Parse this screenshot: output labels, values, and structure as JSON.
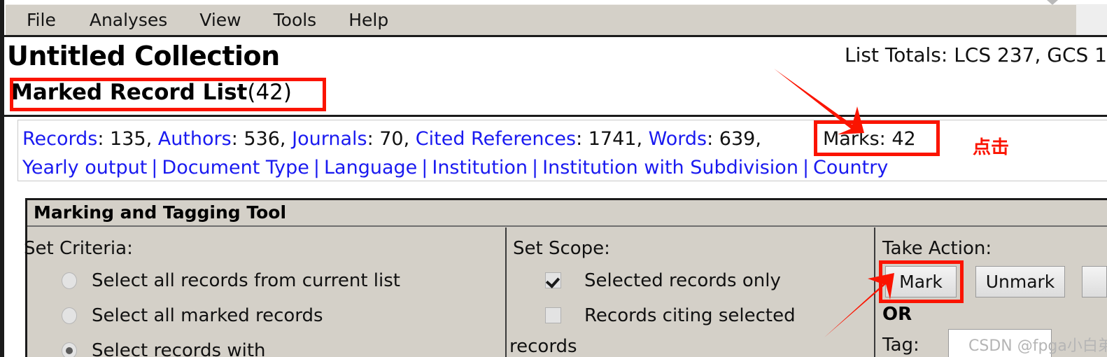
{
  "menubar": {
    "items": [
      {
        "label": "File"
      },
      {
        "label": "Analyses"
      },
      {
        "label": "View"
      },
      {
        "label": "Tools"
      },
      {
        "label": "Help"
      }
    ]
  },
  "header": {
    "collection_title": "Untitled Collection",
    "list_totals": "List Totals: LCS 237, GCS 1",
    "subtitle_label": "Marked Record List",
    "subtitle_count": "(42)"
  },
  "stats": {
    "line1": [
      {
        "text": "Records",
        "type": "link"
      },
      {
        "text": ": 135, ",
        "type": "plain"
      },
      {
        "text": "Authors",
        "type": "link"
      },
      {
        "text": ": 536, ",
        "type": "plain"
      },
      {
        "text": "Journals",
        "type": "link"
      },
      {
        "text": ": 70, ",
        "type": "plain"
      },
      {
        "text": "Cited References",
        "type": "link"
      },
      {
        "text": ": 1741, ",
        "type": "plain"
      },
      {
        "text": "Words",
        "type": "link"
      },
      {
        "text": ": 639,",
        "type": "plain"
      }
    ],
    "line1_flat": "Records: 135, Authors: 536, Journals: 70, Cited References: 1741, Words: 639,",
    "records_label": "Records",
    "records_value": ": 135, ",
    "authors_label": "Authors",
    "authors_value": ": 536, ",
    "journals_label": "Journals",
    "journals_value": ": 70, ",
    "cited_refs_label": "Cited References",
    "cited_refs_value": ": 1741, ",
    "words_label": "Words",
    "words_value": ": 639,",
    "marks_text": "Marks: 42",
    "links_row": [
      {
        "label": "Yearly output"
      },
      {
        "label": "Document Type"
      },
      {
        "label": "Language"
      },
      {
        "label": "Institution"
      },
      {
        "label": "Institution with Subdivision"
      },
      {
        "label": "Country"
      }
    ],
    "separator": "|"
  },
  "annotations": {
    "click_note": "点击",
    "watermark": "CSDN @fpga小白弟",
    "highlight_color": "#fb1400"
  },
  "tool": {
    "title": "Marking and Tagging Tool",
    "criteria": {
      "heading": "Set Criteria:",
      "options": [
        {
          "label": "Select all records from current list",
          "selected": false
        },
        {
          "label": "Select all marked records",
          "selected": false
        },
        {
          "label": "Select records with",
          "selected": true
        }
      ]
    },
    "scope": {
      "heading": "Set Scope:",
      "options": [
        {
          "label": "Selected records only",
          "checked": true
        },
        {
          "label": "Records citing selected",
          "checked": false
        }
      ],
      "wrapped_word": "records"
    },
    "action": {
      "heading": "Take Action:",
      "mark_label": "Mark",
      "unmark_label": "Unmark",
      "or_label": "OR",
      "tag_label": "Tag:",
      "tag_value": "",
      "tag_placeholder": ""
    }
  }
}
